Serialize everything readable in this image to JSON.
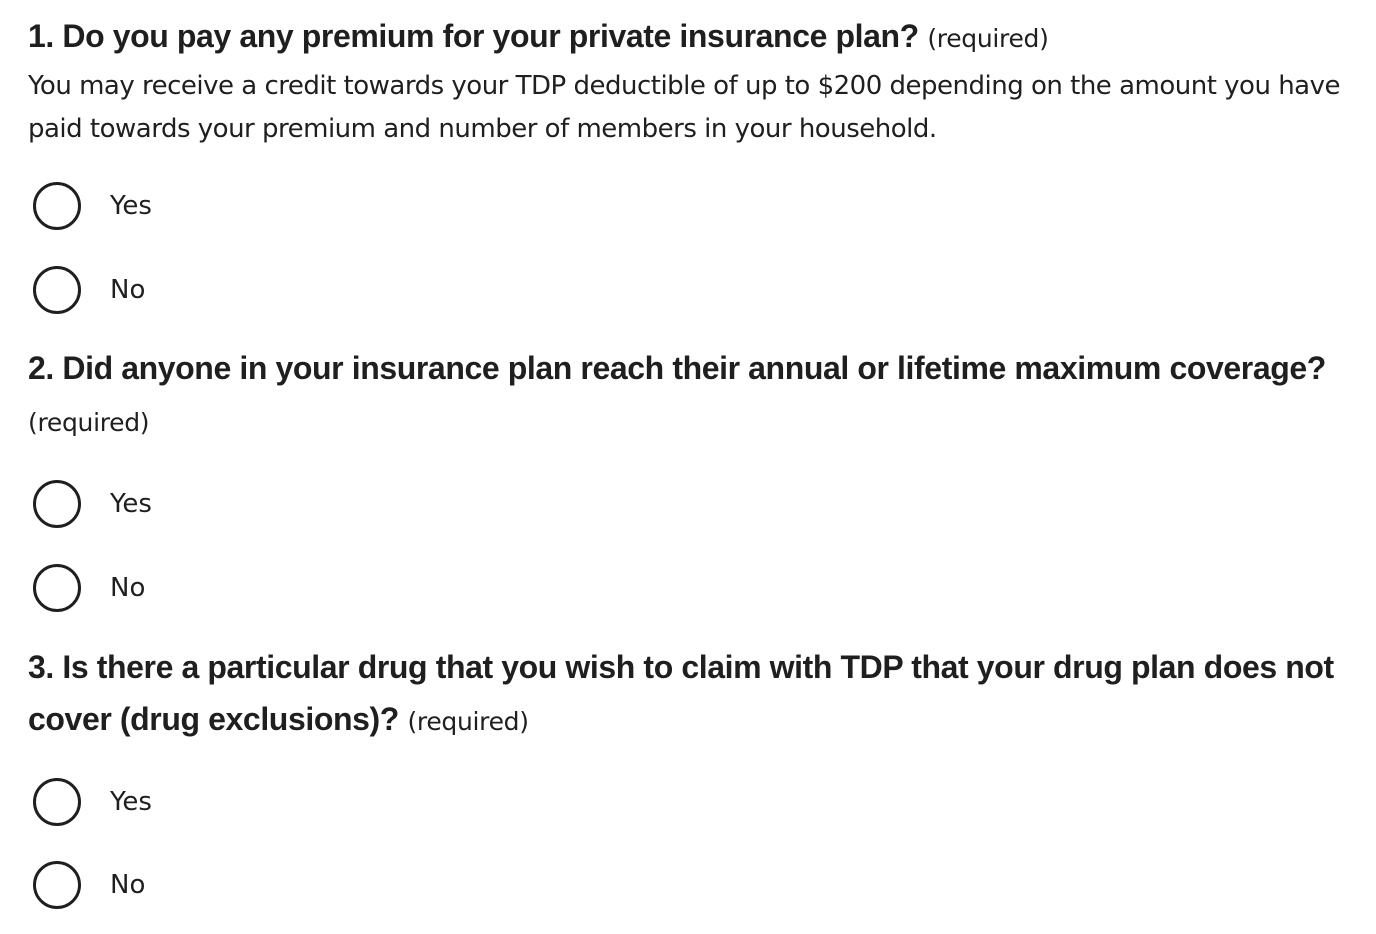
{
  "questions": [
    {
      "number_title": "1. Do you pay any premium for your private insurance plan?",
      "required": "(required)",
      "hint": "You may receive a credit towards your TDP deductible of up to $200 depending on the amount you have paid towards your premium and number of members in your household.",
      "options": [
        {
          "label": "Yes",
          "selected": false
        },
        {
          "label": "No",
          "selected": false
        }
      ]
    },
    {
      "number_title": "2. Did anyone in your insurance plan reach their annual or lifetime maximum coverage?",
      "required": "(required)",
      "options": [
        {
          "label": "Yes",
          "selected": false
        },
        {
          "label": "No",
          "selected": false
        }
      ]
    },
    {
      "number_title": "3. Is there a particular drug that you wish to claim with TDP that your drug plan does not cover (drug exclusions)?",
      "required": "(required)",
      "options": [
        {
          "label": "Yes",
          "selected": false
        },
        {
          "label": "No",
          "selected": false
        }
      ]
    }
  ]
}
